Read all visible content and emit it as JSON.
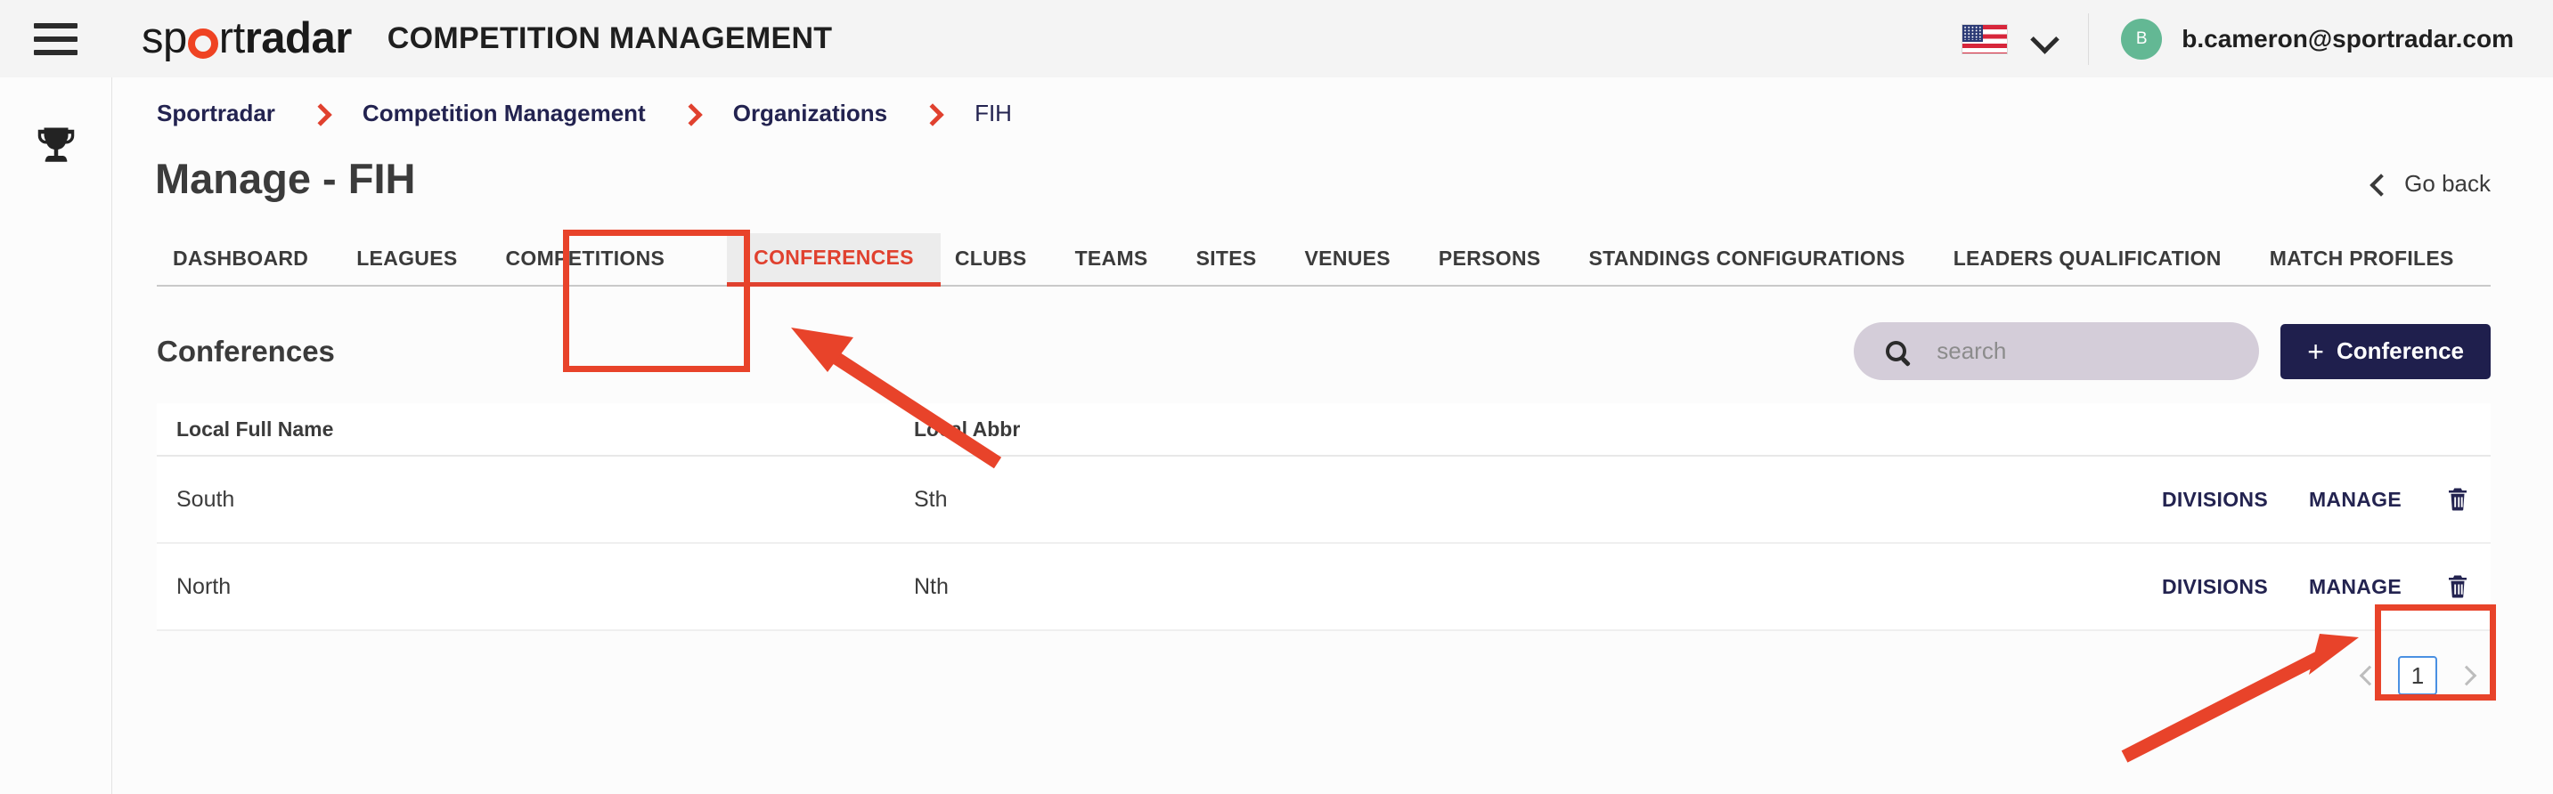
{
  "header": {
    "menu_icon": "hamburger-icon",
    "logo_text_1": "sp",
    "logo_text_2": "rt",
    "logo_text_3": "radar",
    "app_title": "COMPETITION MANAGEMENT",
    "language_flag": "us-flag-icon",
    "language_chevron": "chevron-down-icon",
    "avatar_initial": "B",
    "user_email": "b.cameron@sportradar.com"
  },
  "sidebar": {
    "trophy_icon": "trophy-icon"
  },
  "breadcrumb": {
    "items": [
      {
        "label": "Sportradar",
        "is_last": false
      },
      {
        "label": "Competition Management",
        "is_last": false
      },
      {
        "label": "Organizations",
        "is_last": false
      },
      {
        "label": "FIH",
        "is_last": true
      }
    ]
  },
  "page": {
    "title": "Manage - FIH",
    "go_back_label": "Go back",
    "go_back_icon": "chevron-left-icon"
  },
  "tabs": {
    "active": "CONFERENCES",
    "items": [
      "DASHBOARD",
      "LEAGUES",
      "COMPETITIONS",
      "CONFERENCES",
      "CLUBS",
      "TEAMS",
      "SITES",
      "VENUES",
      "PERSONS",
      "STANDINGS CONFIGURATIONS",
      "LEADERS QUALIFICATION",
      "MATCH PROFILES"
    ]
  },
  "section": {
    "title": "Conferences",
    "search": {
      "placeholder": "search",
      "value": "",
      "icon": "search-icon"
    },
    "add_button": {
      "plus": "+",
      "label": "Conference"
    }
  },
  "table": {
    "columns": [
      "Local Full Name",
      "Local Abbr"
    ],
    "rows": [
      {
        "local_full_name": "South",
        "local_abbr": "Sth",
        "divisions_label": "DIVISIONS",
        "manage_label": "MANAGE",
        "delete_icon": "trash-icon"
      },
      {
        "local_full_name": "North",
        "local_abbr": "Nth",
        "divisions_label": "DIVISIONS",
        "manage_label": "MANAGE",
        "delete_icon": "trash-icon"
      }
    ]
  },
  "pagination": {
    "prev_icon": "chevron-left-icon",
    "next_icon": "chevron-right-icon",
    "current_page": "1"
  },
  "annotations": {
    "color": "#e8432a",
    "highlight_boxes": [
      "conferences-tab",
      "row-2-delete-action"
    ],
    "arrows": [
      "arrow-to-conferences-tab",
      "arrow-to-row-2-delete"
    ]
  }
}
